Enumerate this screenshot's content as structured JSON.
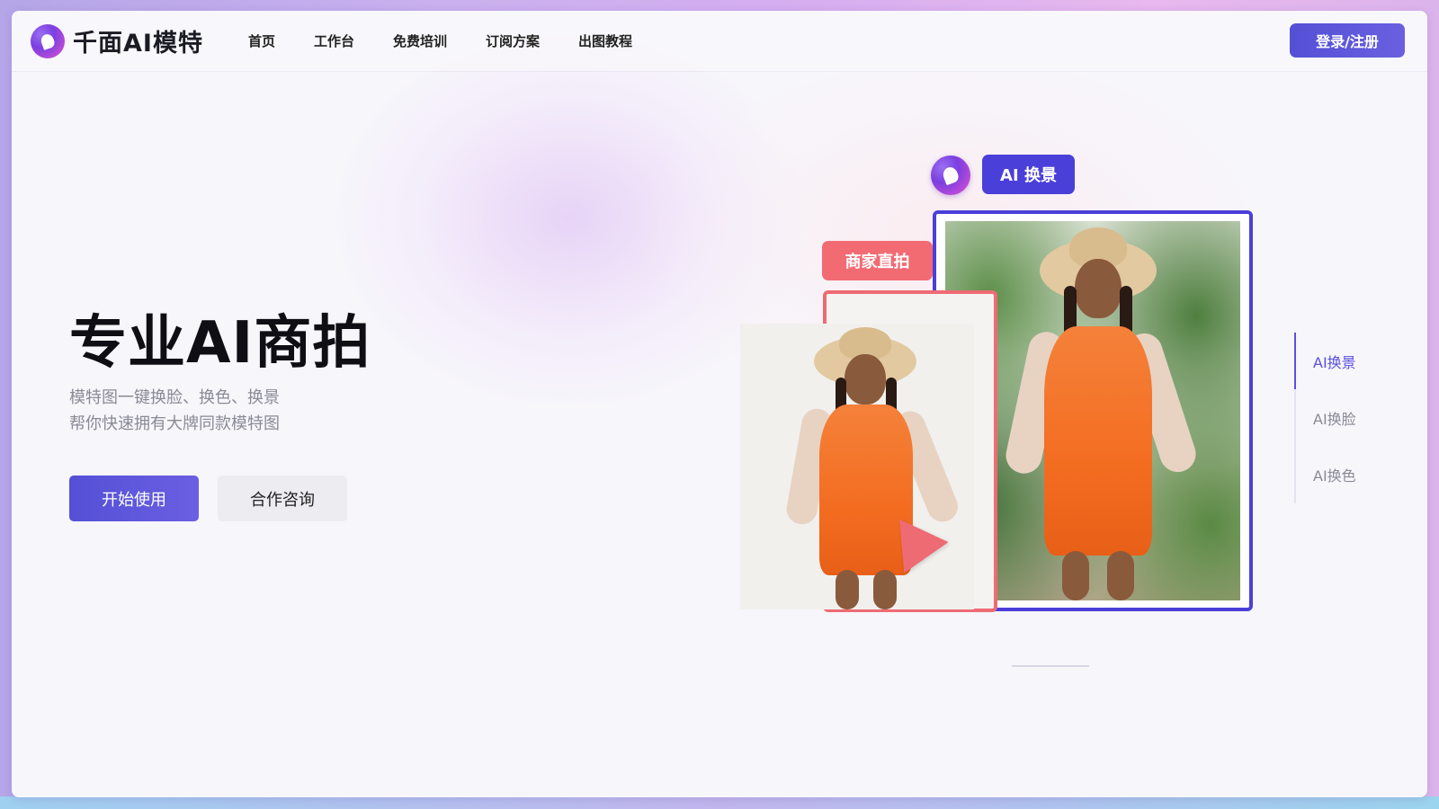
{
  "header": {
    "brand_name": "千面AI模特",
    "nav": [
      "首页",
      "工作台",
      "免费培训",
      "订阅方案",
      "出图教程"
    ],
    "login_label": "登录/注册"
  },
  "hero": {
    "title": "专业AI商拍",
    "subtitle_line1": "模特图一键换脸、换色、换景",
    "subtitle_line2": "帮你快速拥有大牌同款模特图",
    "primary_button": "开始使用",
    "secondary_button": "合作咨询"
  },
  "showcase": {
    "badge_main": "AI 换景",
    "badge_merchant": "商家直拍",
    "side_tabs": [
      {
        "label": "AI换景",
        "active": true
      },
      {
        "label": "AI换脸",
        "active": false
      },
      {
        "label": "AI换色",
        "active": false
      }
    ]
  },
  "colors": {
    "accent": "#4b3fd9",
    "merchant_red": "#ee6b74",
    "dress_orange": "#f36d21"
  },
  "icons": {
    "brand_logo": "brand-face-logo-icon",
    "cursor": "pointer-cursor-icon"
  }
}
